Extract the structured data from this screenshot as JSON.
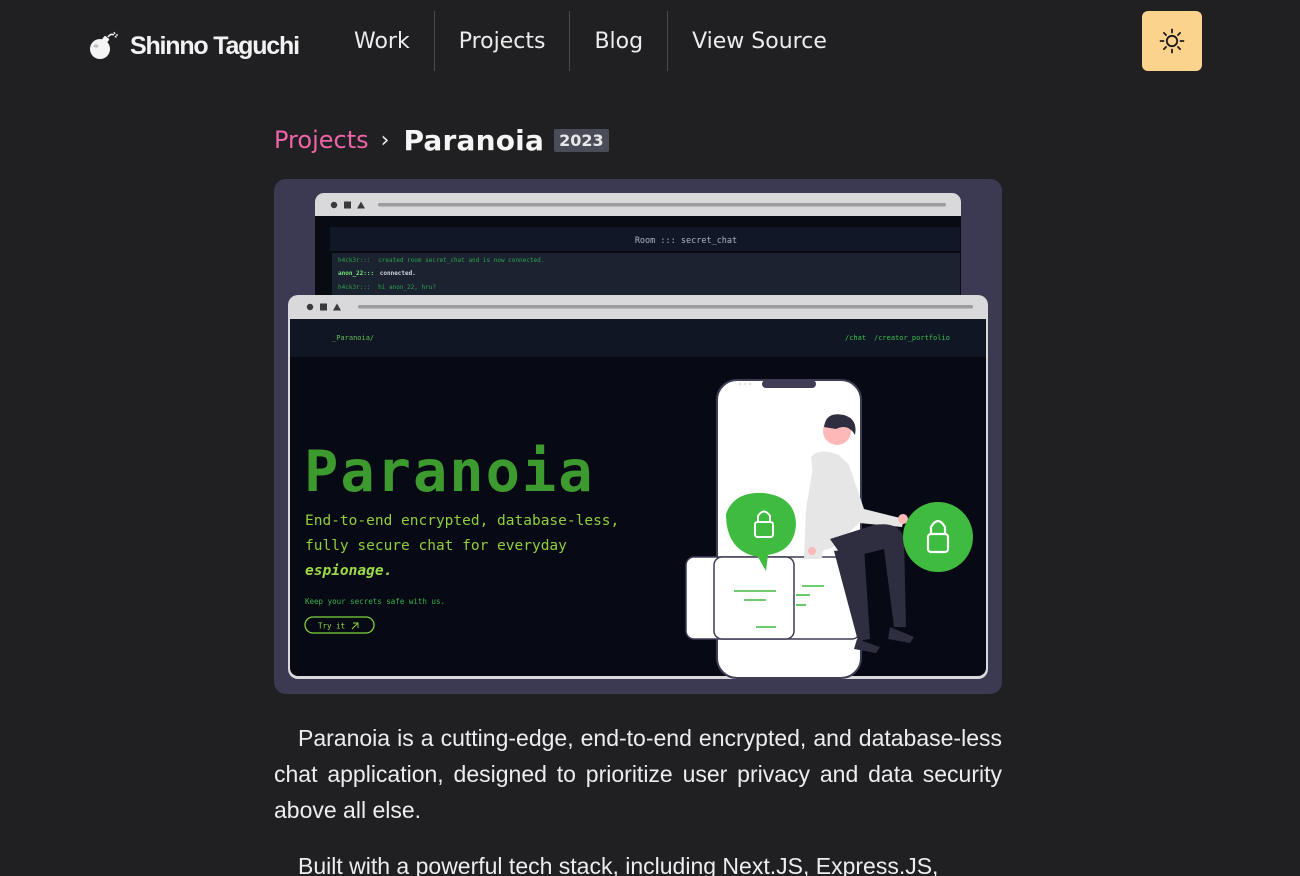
{
  "header": {
    "logo_icon": "bomb-icon",
    "logo_text": "Shinno Taguchi",
    "nav": [
      {
        "label": "Work"
      },
      {
        "label": "Projects"
      },
      {
        "label": "Blog"
      },
      {
        "label": "View Source"
      }
    ],
    "theme_toggle_icon": "sun-icon",
    "theme_toggle_color": "#fbd38d"
  },
  "breadcrumb": {
    "parent": "Projects",
    "separator": "›",
    "title": "Paranoia",
    "year": "2023"
  },
  "hero": {
    "back_window": {
      "room_title": "Room ::: secret_chat",
      "messages": [
        {
          "user": "h4ck3r:::",
          "text": "created room secret_chat and is now connected."
        },
        {
          "user": "anon_22:::",
          "text": "connected."
        },
        {
          "user": "h4ck3r:::",
          "text": "hi anon_22, hru?"
        }
      ]
    },
    "front_window": {
      "brand": "_Paranoia/",
      "nav": [
        "/chat",
        "/creator_portfolio"
      ],
      "title": "Paranoia",
      "tagline_line1": "End-to-end encrypted, database-less,",
      "tagline_line2": "fully secure chat for everyday",
      "tagline_emphasis": "espionage.",
      "subtext": "Keep your secrets safe with us.",
      "cta": "Try it"
    },
    "accent_green": "#3fbb3f",
    "title_green": "#3c9a2e"
  },
  "content": {
    "paragraph1": "Paranoia is a cutting-edge, end-to-end encrypted, and database-less chat application, designed to prioritize user privacy and data security above all else.",
    "paragraph2": "Built with a powerful tech stack, including Next.JS, Express.JS,"
  },
  "colors": {
    "background": "#202023",
    "accent_pink": "#ed64a6"
  }
}
